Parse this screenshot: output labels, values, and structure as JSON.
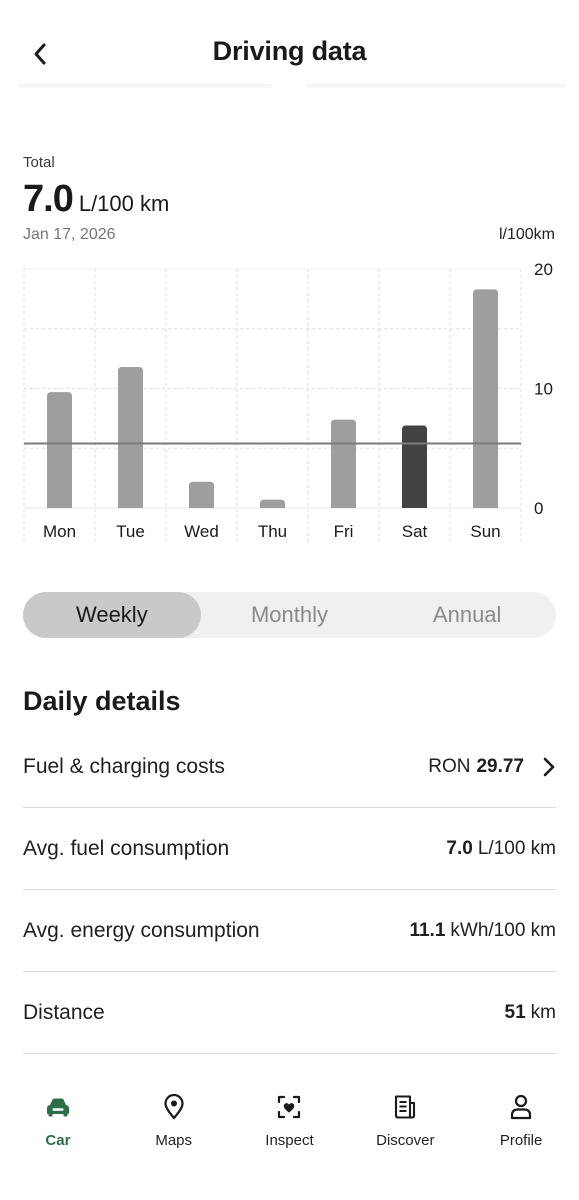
{
  "header": {
    "title": "Driving data"
  },
  "summary": {
    "label": "Total",
    "value": "7.0",
    "unit": "L/100 km",
    "date": "Jan 17, 2026",
    "chart_unit": "l/100km"
  },
  "chart_data": {
    "type": "bar",
    "categories": [
      "Mon",
      "Tue",
      "Wed",
      "Thu",
      "Fri",
      "Sat",
      "Sun"
    ],
    "values": [
      9.7,
      11.8,
      2.2,
      0.7,
      7.4,
      6.9,
      18.3
    ],
    "highlight_index": 5,
    "average_line": 5.4,
    "ylim": [
      0,
      20
    ],
    "yticks": [
      0,
      10,
      20
    ],
    "y_axis_side": "right",
    "grid": true,
    "colors": {
      "bar": "#9e9e9e",
      "highlight": "#424242",
      "average_line": "#7a7a7a",
      "grid": "#dedede"
    }
  },
  "period_toggle": {
    "options": [
      "Weekly",
      "Monthly",
      "Annual"
    ],
    "selected": "Weekly"
  },
  "daily_details": {
    "title": "Daily details",
    "rows": [
      {
        "label": "Fuel & charging costs",
        "prefix": "RON",
        "value": "29.77",
        "unit": ""
      },
      {
        "label": "Avg. fuel consumption",
        "prefix": "",
        "value": "7.0",
        "unit": "L/100 km"
      },
      {
        "label": "Avg. energy consumption",
        "prefix": "",
        "value": "11.1",
        "unit": "kWh/100 km"
      },
      {
        "label": "Distance",
        "prefix": "",
        "value": "51",
        "unit": "km"
      }
    ]
  },
  "bottom_nav": {
    "accent": "#2c6e49",
    "items": [
      {
        "label": "Car",
        "icon": "car-icon"
      },
      {
        "label": "Maps",
        "icon": "map-pin-icon"
      },
      {
        "label": "Inspect",
        "icon": "inspect-heart-icon"
      },
      {
        "label": "Discover",
        "icon": "news-icon"
      },
      {
        "label": "Profile",
        "icon": "person-icon"
      }
    ],
    "active": "Car"
  }
}
